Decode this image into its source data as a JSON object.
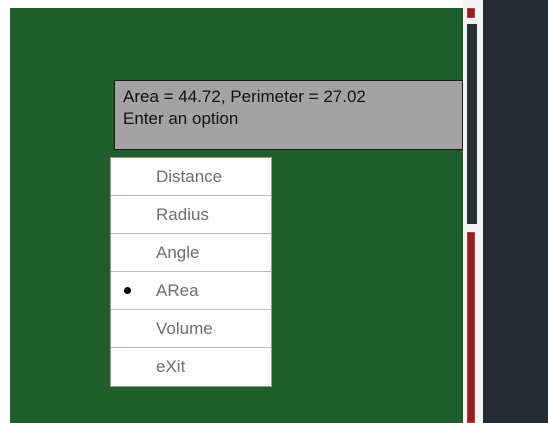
{
  "tooltip": {
    "line1": "Area = 44.72, Perimeter = 27.02",
    "line2": "Enter an option"
  },
  "menu": {
    "items": [
      {
        "label": "Distance",
        "selected": false
      },
      {
        "label": "Radius",
        "selected": false
      },
      {
        "label": "Angle",
        "selected": false
      },
      {
        "label": "ARea",
        "selected": true
      },
      {
        "label": "Volume",
        "selected": false
      },
      {
        "label": "eXit",
        "selected": false
      }
    ],
    "selected_marker": "bullet-icon"
  },
  "colors": {
    "drawing_background": "#1e5e2b",
    "tooltip_background": "#a3a3a3",
    "side_panel": "#252b35",
    "scrollbar_red": "#9a1b1f"
  }
}
